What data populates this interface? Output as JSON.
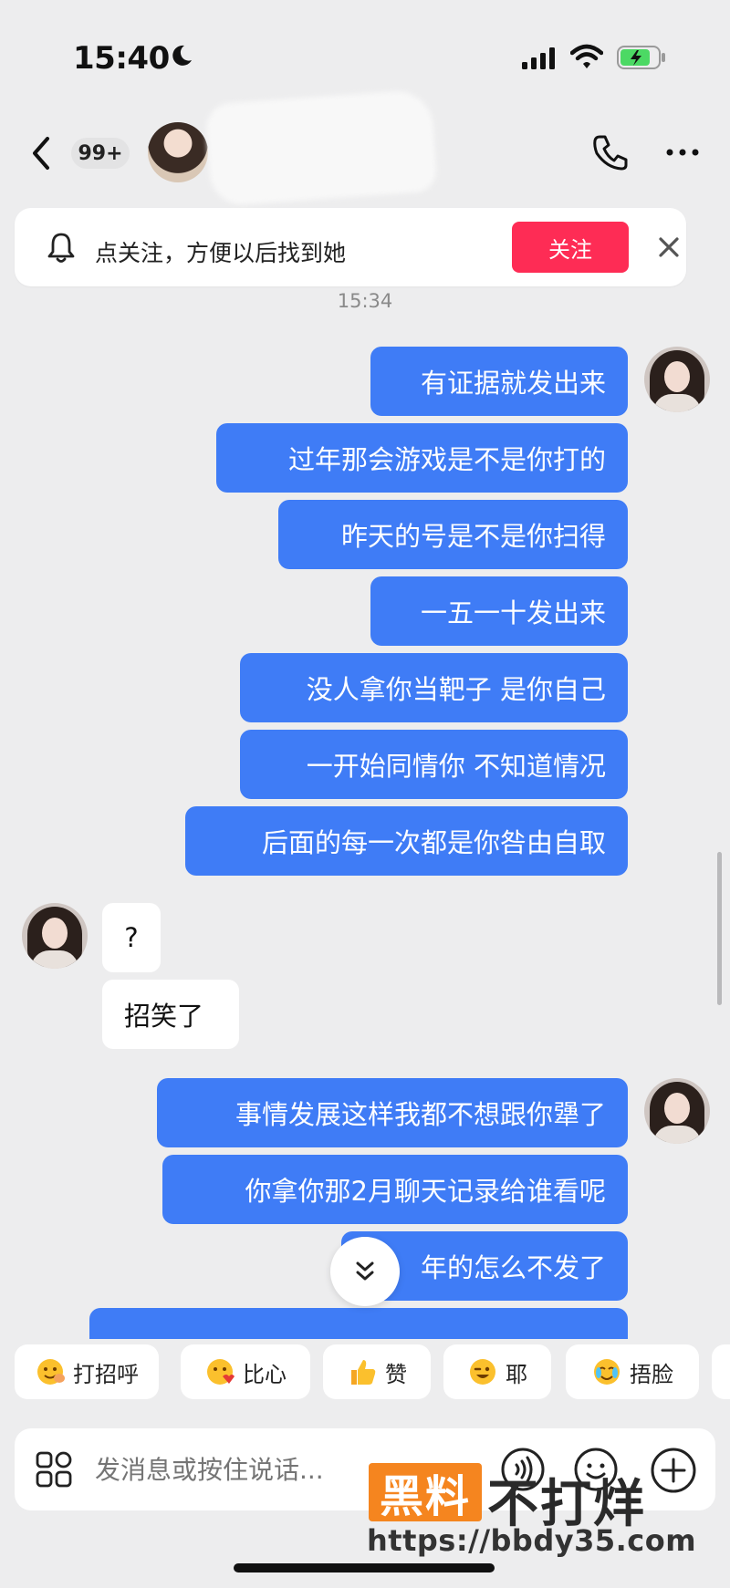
{
  "status_bar": {
    "time": "15:40"
  },
  "header": {
    "unread_count": "99+"
  },
  "follow_banner": {
    "text": "点关注，方便以后找到她",
    "button_label": "关注"
  },
  "chat": {
    "timestamp": "15:34",
    "messages": [
      {
        "sender": "me",
        "text": "有证据就发出来"
      },
      {
        "sender": "me",
        "text": "过年那会游戏是不是你打的"
      },
      {
        "sender": "me",
        "text": "昨天的号是不是你扫得"
      },
      {
        "sender": "me",
        "text": "一五一十发出来"
      },
      {
        "sender": "me",
        "text": "没人拿你当靶子 是你自己"
      },
      {
        "sender": "me",
        "text": "一开始同情你 不知道情况"
      },
      {
        "sender": "me",
        "text": "后面的每一次都是你咎由自取"
      },
      {
        "sender": "them",
        "text": "?"
      },
      {
        "sender": "them",
        "text": "招笑了"
      },
      {
        "sender": "me",
        "text": "事情发展这样我都不想跟你犟了"
      },
      {
        "sender": "me",
        "text": "你拿你那2月聊天记录给谁看呢"
      },
      {
        "sender": "me",
        "text": "年的怎么不发了"
      }
    ]
  },
  "quick_replies": [
    {
      "icon": "wave-emoji-icon",
      "label": "打招呼"
    },
    {
      "icon": "heart-hands-emoji-icon",
      "label": "比心"
    },
    {
      "icon": "thumbs-up-emoji-icon",
      "label": "赞"
    },
    {
      "icon": "wink-emoji-icon",
      "label": "耶"
    },
    {
      "icon": "facepalm-emoji-icon",
      "label": "捂脸"
    }
  ],
  "input": {
    "placeholder": "发消息或按住说话..."
  },
  "watermark": {
    "box": "黑料",
    "text": "不打烊",
    "url": "https://bbdy35.com"
  },
  "colors": {
    "sent_bubble": "#3f7cf6",
    "follow_button": "#fe2c55",
    "background": "#ededee"
  }
}
